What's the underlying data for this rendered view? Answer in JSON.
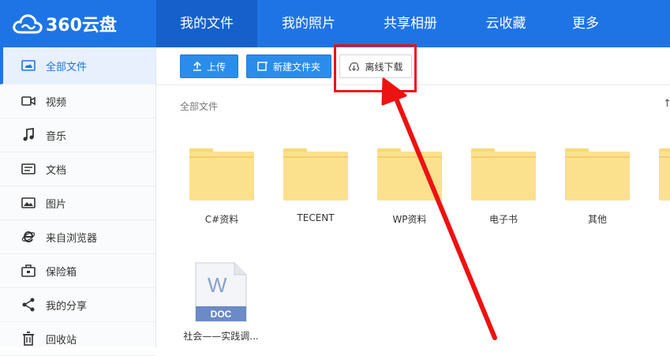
{
  "brand": {
    "name": "360云盘"
  },
  "nav": {
    "items": [
      "我的文件",
      "我的照片",
      "共享相册",
      "云收藏",
      "更多"
    ]
  },
  "sidebar": {
    "items": [
      {
        "label": "全部文件",
        "icon": "cloud-drive-icon"
      },
      {
        "label": "视频",
        "icon": "video-icon"
      },
      {
        "label": "音乐",
        "icon": "music-icon"
      },
      {
        "label": "文档",
        "icon": "document-icon"
      },
      {
        "label": "图片",
        "icon": "image-icon"
      },
      {
        "label": "来自浏览器",
        "icon": "browser-icon"
      },
      {
        "label": "保险箱",
        "icon": "safe-icon"
      },
      {
        "label": "我的分享",
        "icon": "share-icon"
      },
      {
        "label": "回收站",
        "icon": "trash-icon"
      }
    ]
  },
  "toolbar": {
    "upload": "上传",
    "new_folder": "新建文件夹",
    "offline_download": "离线下载"
  },
  "breadcrumb": "全部文件",
  "sort_icon": "↑",
  "files": {
    "folders": [
      "C#资料",
      "TECENT",
      "WP资料",
      "电子书",
      "其他"
    ],
    "document": {
      "name": "社会——实践调...",
      "badge": "DOC",
      "glyph": "W"
    }
  },
  "colors": {
    "accent": "#1f74e5",
    "highlight": "#ee1111",
    "folder": "#fbe08e"
  }
}
